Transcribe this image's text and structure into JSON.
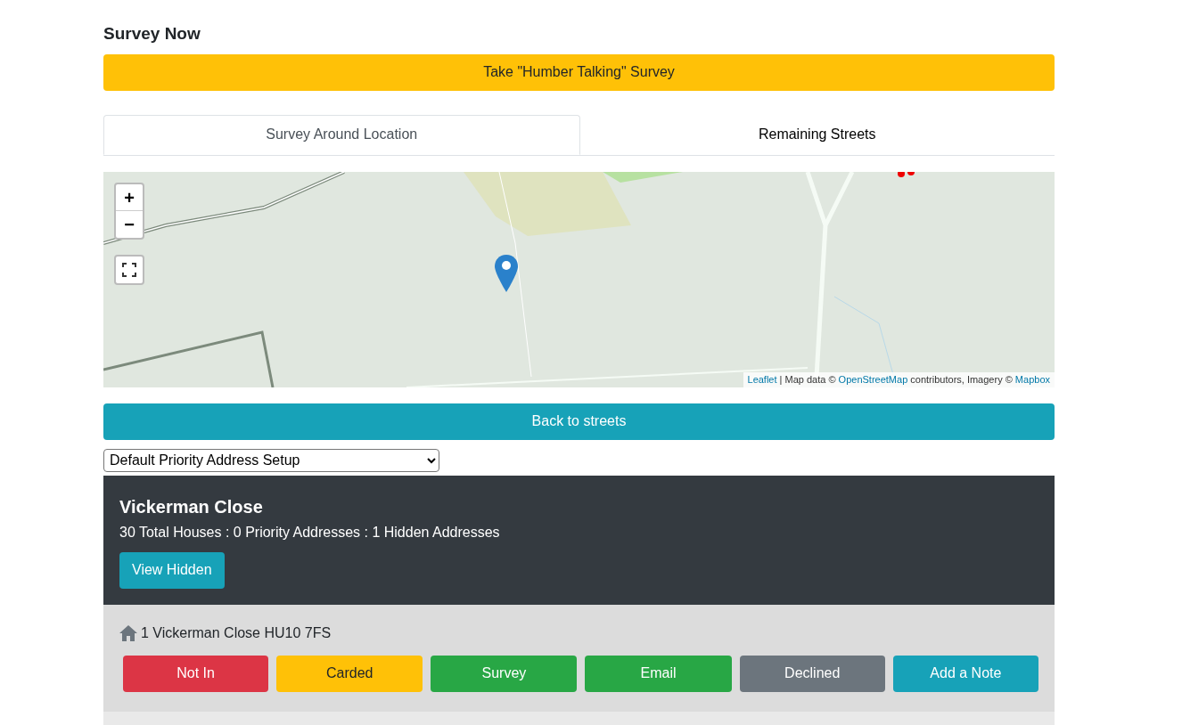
{
  "heading": "Survey Now",
  "survey_button": "Take \"Humber Talking\" Survey",
  "tabs": [
    {
      "label": "Survey Around Location",
      "selected": true
    },
    {
      "label": "Remaining Streets",
      "selected": false
    }
  ],
  "map": {
    "zoom_in": "+",
    "zoom_out": "−",
    "attribution": [
      {
        "text": "Leaflet",
        "link": true
      },
      {
        "text": " | Map data © ",
        "link": false
      },
      {
        "text": "OpenStreetMap",
        "link": true
      },
      {
        "text": " contributors, Imagery © ",
        "link": false
      },
      {
        "text": "Mapbox",
        "link": true
      }
    ]
  },
  "back_button": "Back to streets",
  "setup_select": {
    "value": "Default Priority Address Setup"
  },
  "street": {
    "name": "Vickerman Close",
    "summary": "30 Total Houses : 0 Priority Addresses : 1 Hidden Addresses",
    "view_hidden": "View Hidden"
  },
  "addresses": [
    {
      "address": "1 Vickerman Close HU10 7FS",
      "actions": [
        {
          "label": "Not In",
          "kind": "danger"
        },
        {
          "label": "Carded",
          "kind": "warning"
        },
        {
          "label": "Survey",
          "kind": "success"
        },
        {
          "label": "Email",
          "kind": "success"
        },
        {
          "label": "Declined",
          "kind": "secondary"
        },
        {
          "label": "Add a Note",
          "kind": "info"
        }
      ]
    }
  ]
}
